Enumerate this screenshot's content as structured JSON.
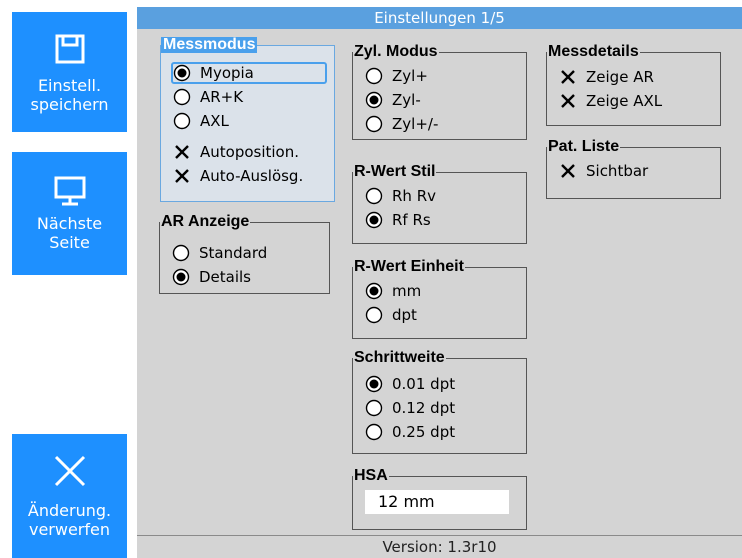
{
  "sidebar": {
    "save": {
      "line1": "Einstell.",
      "line2": "speichern",
      "icon": "floppy-disk-icon"
    },
    "next": {
      "line1": "Nächste",
      "line2": "Seite",
      "icon": "monitor-icon"
    },
    "discard": {
      "line1": "Änderung.",
      "line2": "verwerfen",
      "icon": "close-x-icon"
    }
  },
  "title": "Einstellungen 1/5",
  "version": "Version: 1.3r10",
  "colors": {
    "accent": "#1e90ff",
    "titlebar": "#5aa0df",
    "panel": "#d4d4d4"
  },
  "messmodus": {
    "legend": "Messmodus",
    "options": [
      "Myopia",
      "AR+K",
      "AXL"
    ],
    "selected": "Myopia",
    "checks": [
      {
        "label": "Autoposition.",
        "checked": true
      },
      {
        "label": "Auto-Auslösg.",
        "checked": true
      }
    ]
  },
  "ar_anzeige": {
    "legend": "AR Anzeige",
    "options": [
      "Standard",
      "Details"
    ],
    "selected": "Details"
  },
  "zyl_modus": {
    "legend": "Zyl. Modus",
    "options": [
      "Zyl+",
      "Zyl-",
      "Zyl+/-"
    ],
    "selected": "Zyl-"
  },
  "r_wert_stil": {
    "legend": "R-Wert Stil",
    "options": [
      "Rh Rv",
      "Rf Rs"
    ],
    "selected": "Rf Rs"
  },
  "r_wert_einheit": {
    "legend": "R-Wert Einheit",
    "options": [
      "mm",
      "dpt"
    ],
    "selected": "mm"
  },
  "schrittweite": {
    "legend": "Schrittweite",
    "options": [
      "0.01 dpt",
      "0.12 dpt",
      "0.25 dpt"
    ],
    "selected": "0.01 dpt"
  },
  "hsa": {
    "legend": "HSA",
    "value": "12 mm"
  },
  "messdetails": {
    "legend": "Messdetails",
    "checks": [
      {
        "label": "Zeige AR",
        "checked": true
      },
      {
        "label": "Zeige AXL",
        "checked": true
      }
    ]
  },
  "pat_liste": {
    "legend": "Pat. Liste",
    "checks": [
      {
        "label": "Sichtbar",
        "checked": true
      }
    ]
  }
}
